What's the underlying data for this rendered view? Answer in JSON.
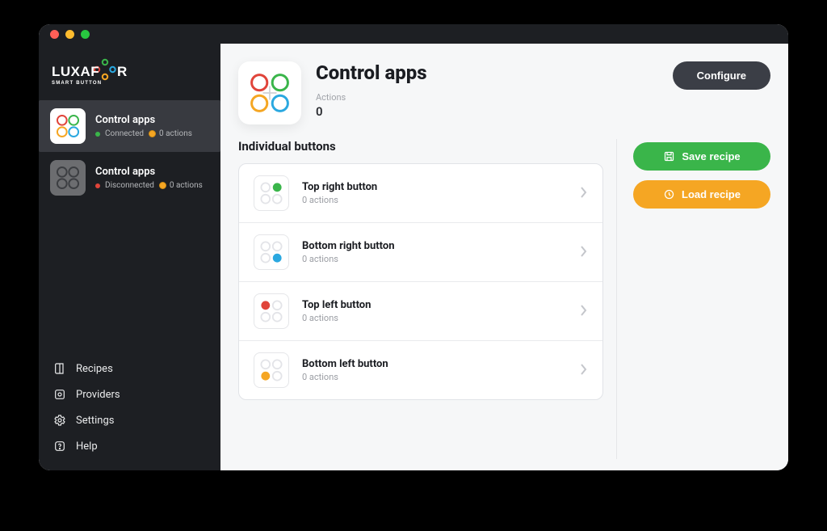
{
  "brand": {
    "name": "LUXAFOR",
    "sub": "SMART BUTTON"
  },
  "colors": {
    "connected": "#3ab54a",
    "disconnected": "#e0443a",
    "green": "#3ab54a",
    "yellow": "#f5a623",
    "red": "#e0443a",
    "blue": "#2aa8e0"
  },
  "devices": [
    {
      "title": "Control apps",
      "status": "Connected",
      "status_color": "#3ab54a",
      "actions_label": "0 actions",
      "active": true
    },
    {
      "title": "Control apps",
      "status": "Disconnected",
      "status_color": "#e0443a",
      "actions_label": "0 actions",
      "active": false
    }
  ],
  "nav": [
    {
      "label": "Recipes"
    },
    {
      "label": "Providers"
    },
    {
      "label": "Settings"
    },
    {
      "label": "Help"
    }
  ],
  "header": {
    "title": "Control apps",
    "actions_caption": "Actions",
    "actions_count": "0",
    "configure_label": "Configure"
  },
  "section_title": "Individual buttons",
  "buttons": [
    {
      "title": "Top right button",
      "sub": "0 actions",
      "dot_color": "#3ab54a",
      "pos": "tr"
    },
    {
      "title": "Bottom right button",
      "sub": "0 actions",
      "dot_color": "#2aa8e0",
      "pos": "br"
    },
    {
      "title": "Top left button",
      "sub": "0 actions",
      "dot_color": "#e0443a",
      "pos": "tl"
    },
    {
      "title": "Bottom left button",
      "sub": "0 actions",
      "dot_color": "#f5a623",
      "pos": "bl"
    }
  ],
  "actions_panel": {
    "save": "Save recipe",
    "load": "Load recipe"
  }
}
